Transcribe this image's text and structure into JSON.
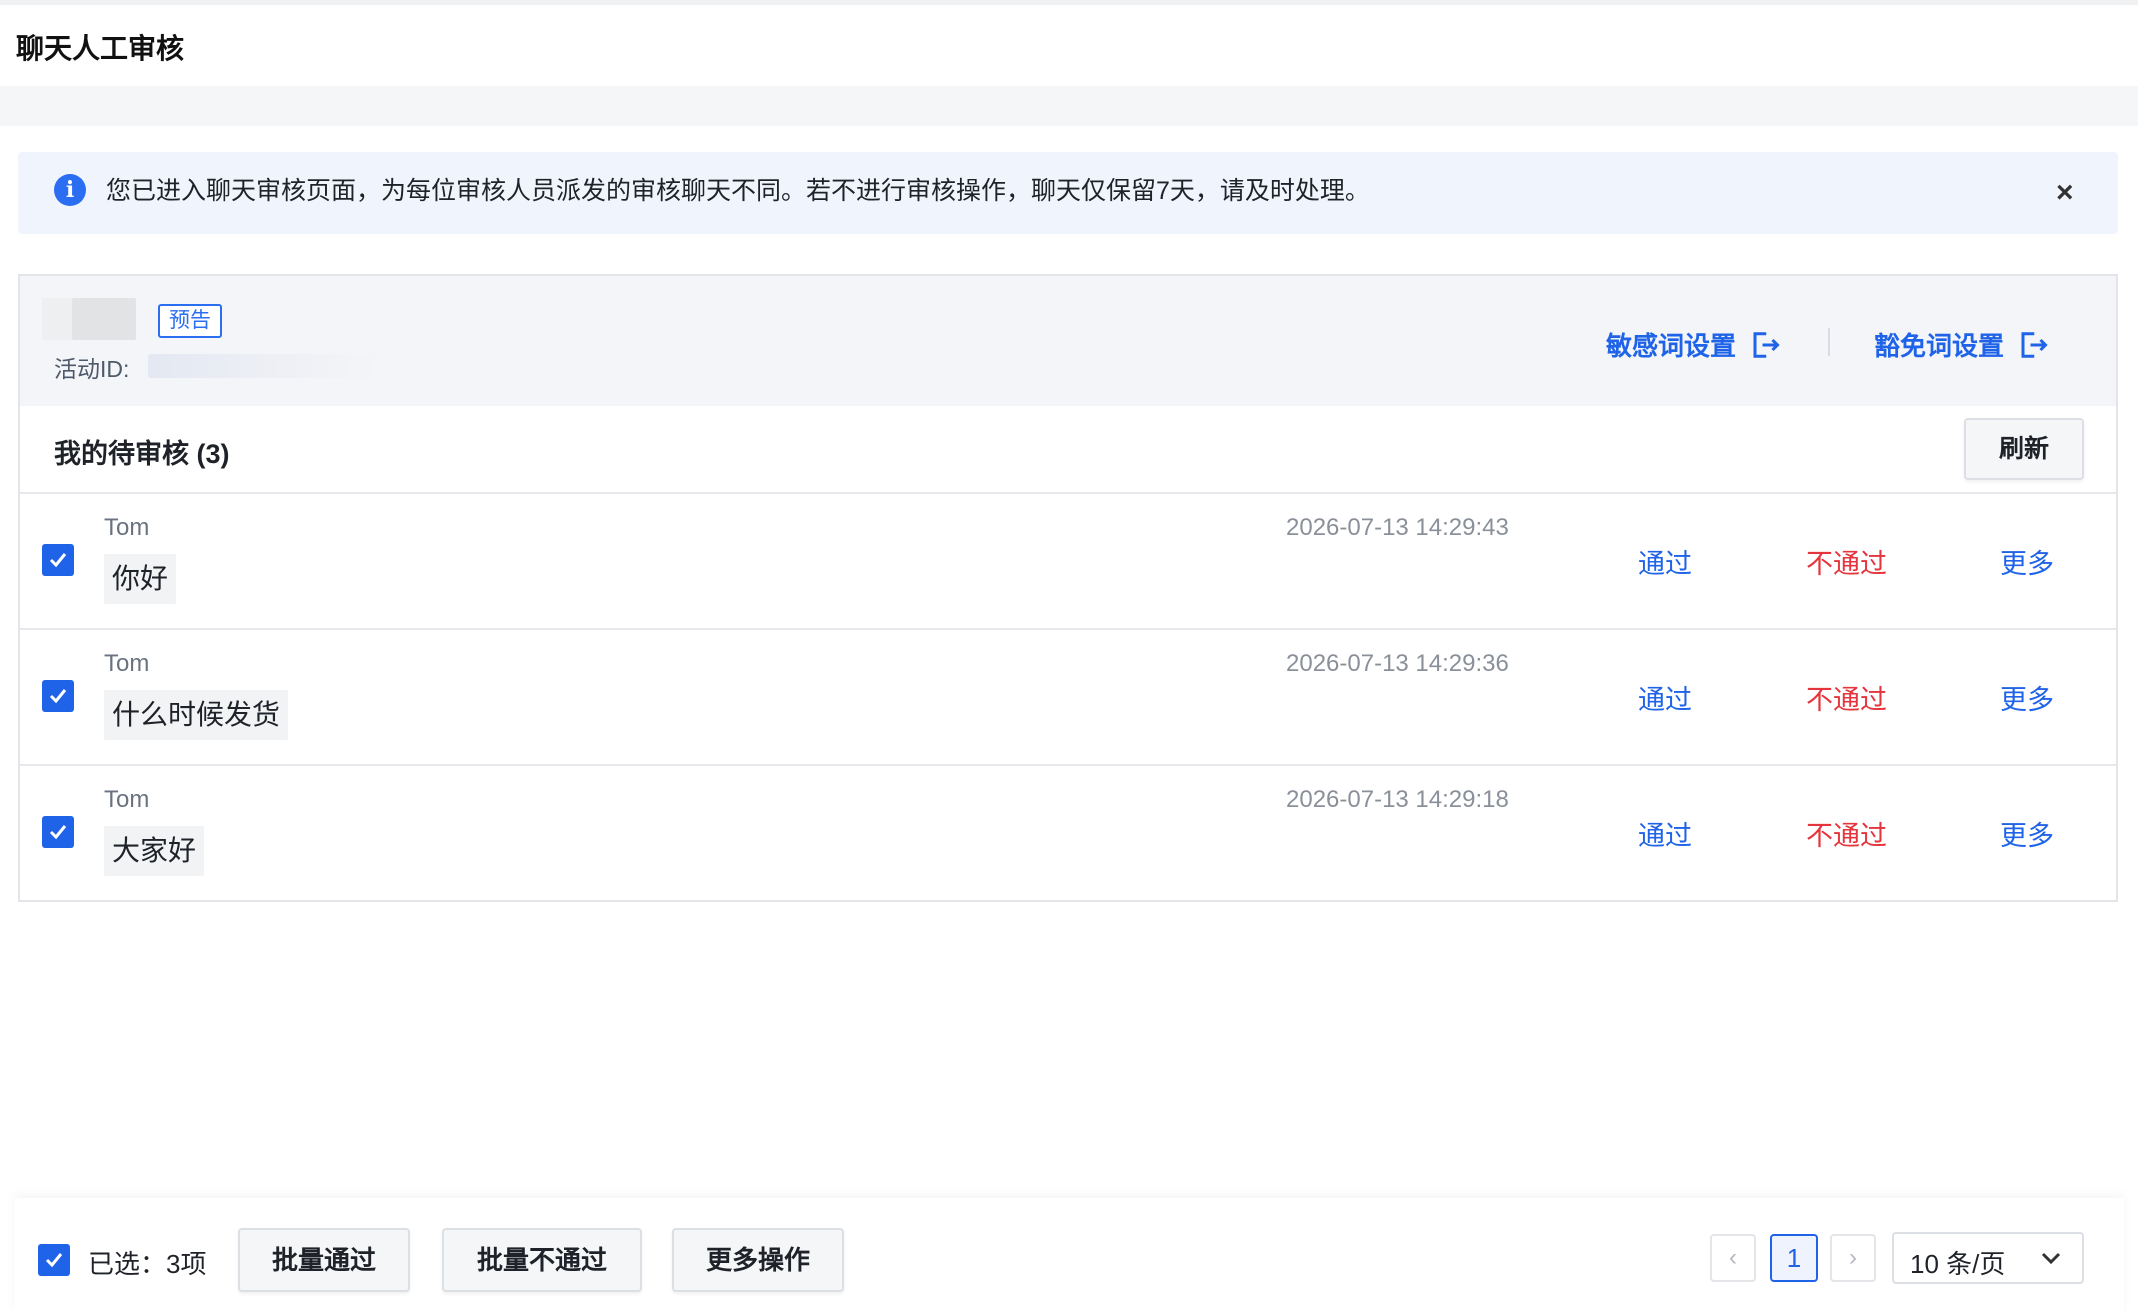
{
  "page": {
    "title": "聊天人工审核"
  },
  "alert": {
    "icon": "info-icon",
    "icon_glyph": "i",
    "text": "您已进入聊天审核页面，为每位审核人员派发的审核聊天不同。若不进行审核操作，聊天仅保留7天，请及时处理。",
    "close": "×"
  },
  "activity": {
    "tag": "预告",
    "id_label": "活动ID:",
    "sensitive_link": "敏感词设置",
    "exempt_link": "豁免词设置"
  },
  "review": {
    "title": "我的待审核 (3)",
    "refresh": "刷新",
    "rows": [
      {
        "user": "Tom",
        "message": "你好",
        "time": "2026-07-13 14:29:43",
        "checked": true
      },
      {
        "user": "Tom",
        "message": "什么时候发货",
        "time": "2026-07-13 14:29:36",
        "checked": true
      },
      {
        "user": "Tom",
        "message": "大家好",
        "time": "2026-07-13 14:29:18",
        "checked": true
      }
    ],
    "actions": {
      "pass": "通过",
      "reject": "不通过",
      "more": "更多"
    }
  },
  "footer": {
    "selected": "已选：3项",
    "batch_pass": "批量通过",
    "batch_reject": "批量不通过",
    "more_ops": "更多操作",
    "pagination": {
      "prev": "‹",
      "current_page": "1",
      "next": "›",
      "page_size": "10 条/页"
    }
  },
  "colors": {
    "accent": "#1f63e8",
    "danger": "#e5343b",
    "alert_bg": "#f0f4fd"
  }
}
